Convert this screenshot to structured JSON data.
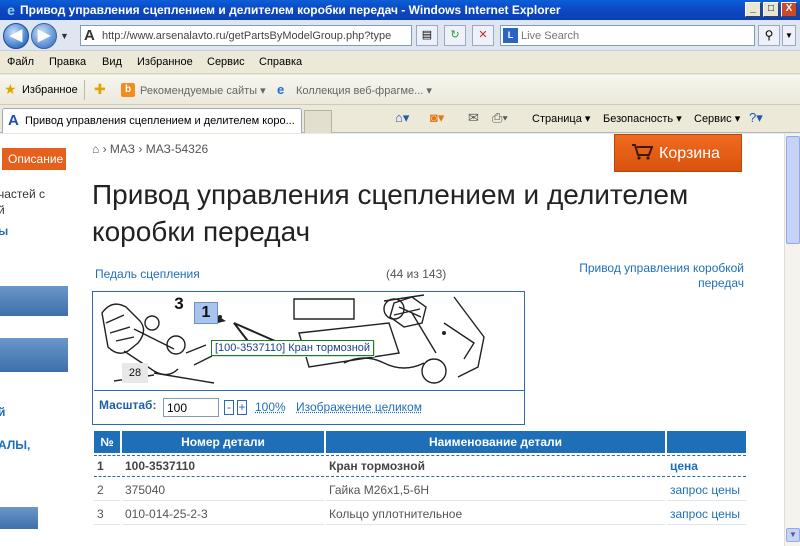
{
  "window": {
    "title": "Привод управления сцеплением и делителем коробки передач - Windows Internet Explorer",
    "min": "_",
    "max": "□",
    "close": "X"
  },
  "address": {
    "url": "http://www.arsenalavto.ru/getPartsByModelGroup.php?type",
    "search_placeholder": "Live Search"
  },
  "menu": [
    "Файл",
    "Правка",
    "Вид",
    "Избранное",
    "Сервис",
    "Справка"
  ],
  "favorites": {
    "label": "Избранное",
    "items": [
      "Рекомендуемые сайты ▾",
      "Коллекция веб-фрагме... ▾"
    ]
  },
  "tab": {
    "label": "Привод управления сцеплением и делителем коро..."
  },
  "commands": {
    "page": "Страница ▾",
    "security": "Безопасность ▾",
    "service": "Сервис ▾"
  },
  "sidebar": {
    "desc_tab": "Описание",
    "text1": "частей с",
    "text2": "й",
    "text3": "ы",
    "text4": "АЛЫ,",
    "text5": "й"
  },
  "breadcrumb": [
    "МАЗ",
    "МАЗ-54326"
  ],
  "cart": {
    "label": "Корзина"
  },
  "page": {
    "title": "Привод управления сцеплением и делителем коробки передач",
    "prev": "Педаль сцепления",
    "counter": "(44 из 143)",
    "next": "Привод управления коробкой передач"
  },
  "viewer": {
    "callouts": {
      "c1": "1",
      "c3": "3",
      "c28": "28"
    },
    "tooltip": "[100-3537110] Кран тормозной",
    "zoom_label": "Масштаб:",
    "zoom_value": "100",
    "minus": "-",
    "plus": "+",
    "zoom_100": "100%",
    "fit": "Изображение целиком"
  },
  "table": {
    "headers": [
      "№",
      "Номер детали",
      "Наименование детали",
      ""
    ],
    "rows": [
      {
        "n": "1",
        "number": "100-3537110",
        "name": "Кран тормозной",
        "price": "цена"
      },
      {
        "n": "2",
        "number": "375040",
        "name": "Гайка М26х1,5-6Н",
        "price": "запрос цены"
      },
      {
        "n": "3",
        "number": "010-014-25-2-3",
        "name": "Кольцо уплотнительное",
        "price": "запрос цены"
      }
    ]
  }
}
